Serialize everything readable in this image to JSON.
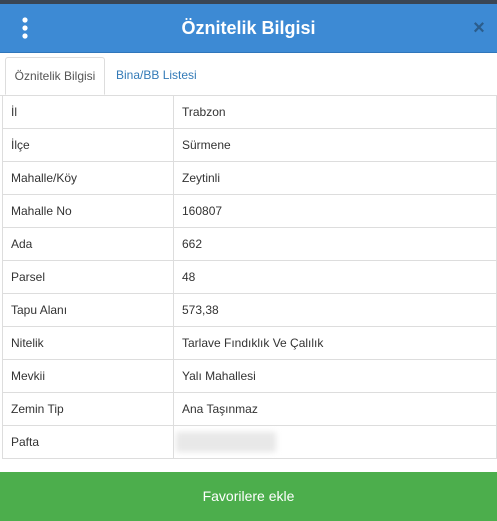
{
  "header": {
    "title": "Öznitelik Bilgisi",
    "menu_icon": "vertical-ellipsis-icon",
    "close_icon": "close-icon",
    "close_glyph": "×",
    "background_color": "#3d8ad4"
  },
  "tabs": [
    {
      "label": "Öznitelik Bilgisi",
      "active": true
    },
    {
      "label": "Bina/BB Listesi",
      "active": false
    }
  ],
  "attributes": [
    {
      "key": "İl",
      "value": "Trabzon"
    },
    {
      "key": "İlçe",
      "value": "Sürmene"
    },
    {
      "key": "Mahalle/Köy",
      "value": "Zeytinli"
    },
    {
      "key": "Mahalle No",
      "value": "160807"
    },
    {
      "key": "Ada",
      "value": "662"
    },
    {
      "key": "Parsel",
      "value": "48"
    },
    {
      "key": "Tapu Alanı",
      "value": "573,38"
    },
    {
      "key": "Nitelik",
      "value": "Tarlave Fındıklık Ve Çalılık"
    },
    {
      "key": "Mevkii",
      "value": "Yalı Mahallesi"
    },
    {
      "key": "Zemin Tip",
      "value": "Ana Taşınmaz"
    },
    {
      "key": "Pafta",
      "value": ""
    }
  ],
  "footer": {
    "favorite_label": "Favorilere ekle",
    "button_color": "#4cae4c"
  }
}
